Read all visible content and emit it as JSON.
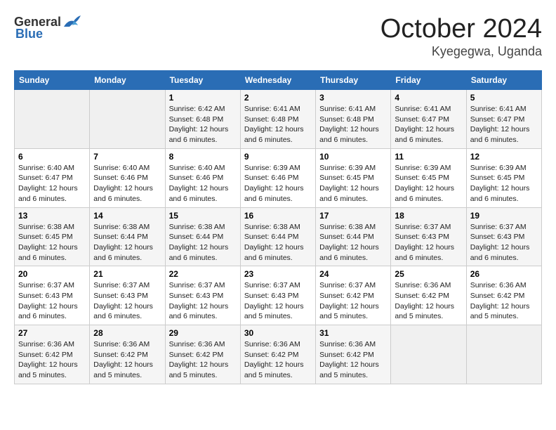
{
  "header": {
    "logo_general": "General",
    "logo_blue": "Blue",
    "month_title": "October 2024",
    "location": "Kyegegwa, Uganda"
  },
  "days_of_week": [
    "Sunday",
    "Monday",
    "Tuesday",
    "Wednesday",
    "Thursday",
    "Friday",
    "Saturday"
  ],
  "weeks": [
    [
      {
        "day": "",
        "info": ""
      },
      {
        "day": "",
        "info": ""
      },
      {
        "day": "1",
        "info": "Sunrise: 6:42 AM\nSunset: 6:48 PM\nDaylight: 12 hours and 6 minutes."
      },
      {
        "day": "2",
        "info": "Sunrise: 6:41 AM\nSunset: 6:48 PM\nDaylight: 12 hours and 6 minutes."
      },
      {
        "day": "3",
        "info": "Sunrise: 6:41 AM\nSunset: 6:48 PM\nDaylight: 12 hours and 6 minutes."
      },
      {
        "day": "4",
        "info": "Sunrise: 6:41 AM\nSunset: 6:47 PM\nDaylight: 12 hours and 6 minutes."
      },
      {
        "day": "5",
        "info": "Sunrise: 6:41 AM\nSunset: 6:47 PM\nDaylight: 12 hours and 6 minutes."
      }
    ],
    [
      {
        "day": "6",
        "info": "Sunrise: 6:40 AM\nSunset: 6:47 PM\nDaylight: 12 hours and 6 minutes."
      },
      {
        "day": "7",
        "info": "Sunrise: 6:40 AM\nSunset: 6:46 PM\nDaylight: 12 hours and 6 minutes."
      },
      {
        "day": "8",
        "info": "Sunrise: 6:40 AM\nSunset: 6:46 PM\nDaylight: 12 hours and 6 minutes."
      },
      {
        "day": "9",
        "info": "Sunrise: 6:39 AM\nSunset: 6:46 PM\nDaylight: 12 hours and 6 minutes."
      },
      {
        "day": "10",
        "info": "Sunrise: 6:39 AM\nSunset: 6:45 PM\nDaylight: 12 hours and 6 minutes."
      },
      {
        "day": "11",
        "info": "Sunrise: 6:39 AM\nSunset: 6:45 PM\nDaylight: 12 hours and 6 minutes."
      },
      {
        "day": "12",
        "info": "Sunrise: 6:39 AM\nSunset: 6:45 PM\nDaylight: 12 hours and 6 minutes."
      }
    ],
    [
      {
        "day": "13",
        "info": "Sunrise: 6:38 AM\nSunset: 6:45 PM\nDaylight: 12 hours and 6 minutes."
      },
      {
        "day": "14",
        "info": "Sunrise: 6:38 AM\nSunset: 6:44 PM\nDaylight: 12 hours and 6 minutes."
      },
      {
        "day": "15",
        "info": "Sunrise: 6:38 AM\nSunset: 6:44 PM\nDaylight: 12 hours and 6 minutes."
      },
      {
        "day": "16",
        "info": "Sunrise: 6:38 AM\nSunset: 6:44 PM\nDaylight: 12 hours and 6 minutes."
      },
      {
        "day": "17",
        "info": "Sunrise: 6:38 AM\nSunset: 6:44 PM\nDaylight: 12 hours and 6 minutes."
      },
      {
        "day": "18",
        "info": "Sunrise: 6:37 AM\nSunset: 6:43 PM\nDaylight: 12 hours and 6 minutes."
      },
      {
        "day": "19",
        "info": "Sunrise: 6:37 AM\nSunset: 6:43 PM\nDaylight: 12 hours and 6 minutes."
      }
    ],
    [
      {
        "day": "20",
        "info": "Sunrise: 6:37 AM\nSunset: 6:43 PM\nDaylight: 12 hours and 6 minutes."
      },
      {
        "day": "21",
        "info": "Sunrise: 6:37 AM\nSunset: 6:43 PM\nDaylight: 12 hours and 6 minutes."
      },
      {
        "day": "22",
        "info": "Sunrise: 6:37 AM\nSunset: 6:43 PM\nDaylight: 12 hours and 6 minutes."
      },
      {
        "day": "23",
        "info": "Sunrise: 6:37 AM\nSunset: 6:43 PM\nDaylight: 12 hours and 5 minutes."
      },
      {
        "day": "24",
        "info": "Sunrise: 6:37 AM\nSunset: 6:42 PM\nDaylight: 12 hours and 5 minutes."
      },
      {
        "day": "25",
        "info": "Sunrise: 6:36 AM\nSunset: 6:42 PM\nDaylight: 12 hours and 5 minutes."
      },
      {
        "day": "26",
        "info": "Sunrise: 6:36 AM\nSunset: 6:42 PM\nDaylight: 12 hours and 5 minutes."
      }
    ],
    [
      {
        "day": "27",
        "info": "Sunrise: 6:36 AM\nSunset: 6:42 PM\nDaylight: 12 hours and 5 minutes."
      },
      {
        "day": "28",
        "info": "Sunrise: 6:36 AM\nSunset: 6:42 PM\nDaylight: 12 hours and 5 minutes."
      },
      {
        "day": "29",
        "info": "Sunrise: 6:36 AM\nSunset: 6:42 PM\nDaylight: 12 hours and 5 minutes."
      },
      {
        "day": "30",
        "info": "Sunrise: 6:36 AM\nSunset: 6:42 PM\nDaylight: 12 hours and 5 minutes."
      },
      {
        "day": "31",
        "info": "Sunrise: 6:36 AM\nSunset: 6:42 PM\nDaylight: 12 hours and 5 minutes."
      },
      {
        "day": "",
        "info": ""
      },
      {
        "day": "",
        "info": ""
      }
    ]
  ]
}
